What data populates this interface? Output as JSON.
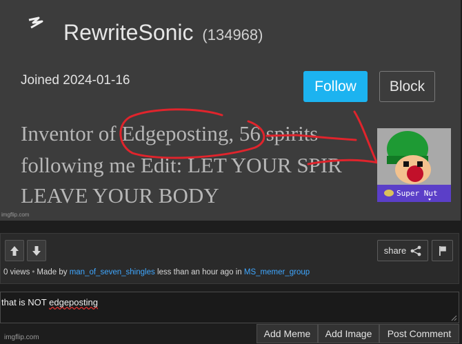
{
  "profile": {
    "username": "RewriteSonic",
    "score": "(134968)",
    "joined": "Joined 2024-01-16",
    "follow_label": "Follow",
    "block_label": "Block",
    "bio_lines": [
      "Inventor of Edgeposting, 56 spirits",
      "following me Edit: LET YOUR SPIR",
      "LEAVE YOUR BODY"
    ],
    "avatar_caption": "Super Nut"
  },
  "watermark": "imgflip.com",
  "actions": {
    "share_label": "share",
    "views": "0 views",
    "made_by_prefix": "Made by",
    "author": "man_of_seven_shingles",
    "time_text": "less than an hour ago in",
    "stream": "MS_memer_group"
  },
  "comment": {
    "text_before": "that is NOT ",
    "misspelled_word": "edgeposting"
  },
  "buttons": {
    "add_meme": "Add Meme",
    "add_image": "Add Image",
    "post_comment": "Post Comment"
  },
  "colors": {
    "accent_blue": "#1cb3f0",
    "link_blue": "#3fa7ff",
    "scribble_red": "#e0242c",
    "avatar_banner": "#5b3fc8"
  },
  "icons": {
    "upvote": "arrow-up-icon",
    "downvote": "arrow-down-icon",
    "share": "share-icon",
    "flag": "flag-icon",
    "logo": "lightning-icon"
  }
}
